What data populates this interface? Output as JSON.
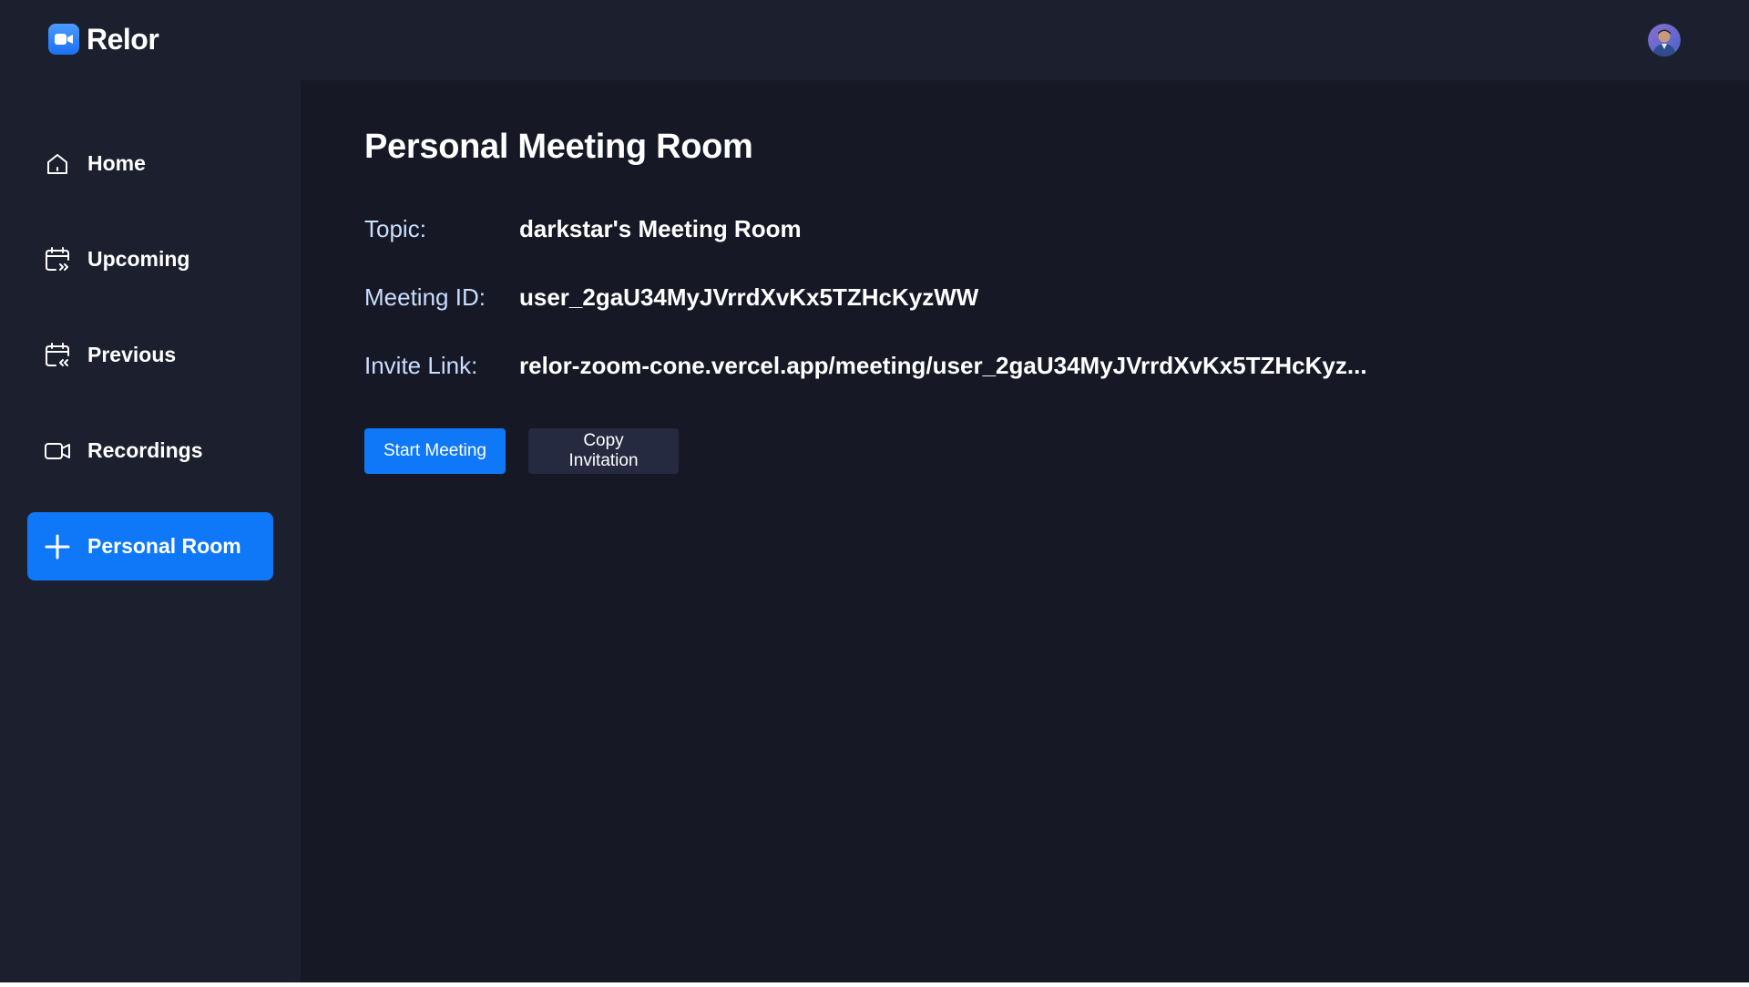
{
  "app": {
    "name": "Relor"
  },
  "navbar": {
    "avatar_icon": "user-avatar"
  },
  "sidebar": {
    "items": [
      {
        "label": "Home",
        "icon": "home-icon",
        "active": false
      },
      {
        "label": "Upcoming",
        "icon": "calendar-upcoming-icon",
        "active": false
      },
      {
        "label": "Previous",
        "icon": "calendar-previous-icon",
        "active": false
      },
      {
        "label": "Recordings",
        "icon": "video-camera-icon",
        "active": false
      },
      {
        "label": "Personal Room",
        "icon": "plus-icon",
        "active": true
      }
    ]
  },
  "main": {
    "title": "Personal Meeting Room",
    "details": [
      {
        "key": "Topic:",
        "value": "darkstar's Meeting Room"
      },
      {
        "key": "Meeting ID:",
        "value": "user_2gaU34MyJVrrdXvKx5TZHcKyzWW"
      },
      {
        "key": "Invite Link:",
        "value": "relor-zoom-cone.vercel.app/meeting/user_2gaU34MyJVrrdXvKx5TZHcKyz..."
      }
    ],
    "buttons": {
      "start": "Start Meeting",
      "copy": "Copy Invitation"
    }
  },
  "colors": {
    "background": "#161925",
    "panel": "#1c1f2e",
    "accent": "#0e78f9",
    "secondary_button": "#252a41",
    "label_text": "#c9ddff"
  }
}
